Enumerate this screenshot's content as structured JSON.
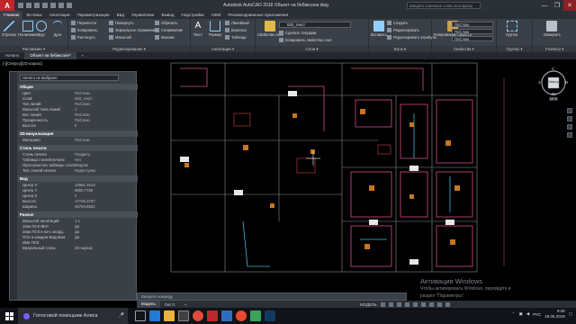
{
  "window": {
    "app_letter": "A",
    "title": "Autodesk AutoCAD 2018   Объект на бебиксоне.dwg",
    "search_placeholder": "Введите ключевое слово или фразу",
    "controls": [
      "—",
      "❐",
      "✕"
    ]
  },
  "ribbon_tabs": [
    "Главная",
    "Вставка",
    "Аннотации",
    "Параметризация",
    "Вид",
    "Управление",
    "Вывод",
    "Надстройки",
    "A360",
    "Рекомендованные приложения"
  ],
  "ribbon": {
    "groups": [
      {
        "label": "Рисование ▾",
        "buttons": [
          "Отрезок",
          "Полилиния",
          "Круг",
          "Дуга"
        ]
      },
      {
        "label": "Редактирование ▾",
        "rows": [
          "Перенести",
          "Копировать",
          "Растянуть",
          "Повернуть",
          "Зеркальное отражение",
          "Масштаб",
          "Обрезать",
          "Сопряжение",
          "Массив"
        ]
      },
      {
        "label": "Аннотации ▾",
        "buttons": [
          "Текст",
          "Размер"
        ],
        "rows": [
          "Линейный",
          "Выноска",
          "Таблица"
        ]
      },
      {
        "label": "Слои ▾",
        "buttons": [
          "Свойства слоя"
        ],
        "rows": [
          "Сделать текущим",
          "Копировать свойства слоя"
        ],
        "layer_value": "020_текст"
      },
      {
        "label": "Блок ▾",
        "buttons": [
          "Вставить"
        ],
        "rows": [
          "Создать",
          "Редактировать",
          "Редактировать атрибуты"
        ]
      },
      {
        "label": "Свойства ▾",
        "buttons": [
          "Копирование свойств"
        ],
        "rows": [
          "ПоСлою",
          "ПоСлою",
          "ПоСлою"
        ]
      },
      {
        "label": "Группы ▾",
        "buttons": [
          "Группа"
        ]
      },
      {
        "label": "Утилиты ▾",
        "buttons": [
          "Измерить"
        ]
      }
    ]
  },
  "doc_tabs": [
    "Начало",
    "Объект на бебиксоне*"
  ],
  "viewport_label": "[-][Сверху][2D-каркас]",
  "properties": {
    "selection": "Ничего не выбрано",
    "sections": [
      {
        "title": "Общие",
        "rows": [
          [
            "Цвет",
            "ПоСлою"
          ],
          [
            "Слой",
            "020_текст"
          ],
          [
            "Тип линий",
            "ПоСлою"
          ],
          [
            "Масштаб типа линий",
            "1"
          ],
          [
            "Вес линий",
            "ПоСлою"
          ],
          [
            "Прозрачность",
            "ПоСлою"
          ],
          [
            "Высота",
            "0"
          ]
        ]
      },
      {
        "title": "3D-визуализация",
        "rows": [
          [
            "Материал",
            "ПоСлою"
          ]
        ]
      },
      {
        "title": "Стиль печати",
        "rows": [
          [
            "Стиль печати",
            "ПоЦвету"
          ],
          [
            "Таблица стилей печати",
            "Нет"
          ],
          [
            "Пространство таблицы стилей печати",
            "Модель"
          ],
          [
            "Тип стилей печати",
            "Недоступно"
          ]
        ]
      },
      {
        "title": "Вид",
        "rows": [
          [
            "Центр X",
            "14061.1513"
          ],
          [
            "Центр Y",
            "9800.7759"
          ],
          [
            "Центр Z",
            "0"
          ],
          [
            "Высота",
            "17728.3757"
          ],
          [
            "Ширина",
            "46794.8922"
          ]
        ]
      },
      {
        "title": "Разное",
        "rows": [
          [
            "Масштаб аннотаций",
            "1:1"
          ],
          [
            "Знак ПСК ВКЛ",
            "Да"
          ],
          [
            "Знак ПСК в нач. коорд.",
            "Да"
          ],
          [
            "ПСК в каждом Видовом",
            "Да"
          ],
          [
            "Имя ПСК",
            ""
          ],
          [
            "Визуальный стиль",
            "2D-каркас"
          ]
        ]
      }
    ]
  },
  "viewcube": {
    "top": "С",
    "face": "Сверху",
    "right": "В",
    "left": "З",
    "bottom": "Ю",
    "ucs": "МСК"
  },
  "cmdline_placeholder": "Введите команду",
  "layout_tabs": [
    "Модель",
    "Лист1",
    "+"
  ],
  "status_model": "МОДЕЛЬ",
  "watermark": [
    "Активация Windows",
    "Чтобы активировать Windows, перейдите в",
    "раздел \"Параметры\"."
  ],
  "taskbar": {
    "search": "Голосовой помощник Алиса",
    "time": "9:26",
    "date": "18.05.2018",
    "lang": "РУС"
  },
  "colors": {
    "accent_red": "#c0262d",
    "canvas_bg": "#000000",
    "panel_bg": "#3b3f46"
  }
}
